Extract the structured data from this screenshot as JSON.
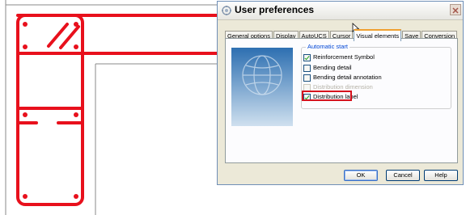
{
  "dialog": {
    "title": "User preferences",
    "icon": "settings-icon",
    "close_icon": "close-icon"
  },
  "tabs": [
    {
      "label": "General options"
    },
    {
      "label": "Display"
    },
    {
      "label": "AutoUCS"
    },
    {
      "label": "Cursor"
    },
    {
      "label": "Visual elements",
      "active": true
    },
    {
      "label": "Save"
    },
    {
      "label": "Conversion"
    }
  ],
  "group": {
    "title": "Automatic start",
    "options": [
      {
        "label": "Reinforcement Symbol",
        "checked": true,
        "enabled": true
      },
      {
        "label": "Bending detail",
        "checked": false,
        "enabled": true
      },
      {
        "label": "Bending detail annotation",
        "checked": false,
        "enabled": true
      },
      {
        "label": "Distribution dimension",
        "checked": false,
        "enabled": false
      },
      {
        "label": "Distribution label",
        "checked": true,
        "enabled": true,
        "highlighted": true
      }
    ]
  },
  "buttons": {
    "ok": "OK",
    "cancel": "Cancel",
    "help": "Help"
  },
  "colors": {
    "rebar": "#e8101c",
    "highlight": "#d6121d",
    "active_tab_accent": "#f0a030",
    "group_title": "#0046d5"
  }
}
